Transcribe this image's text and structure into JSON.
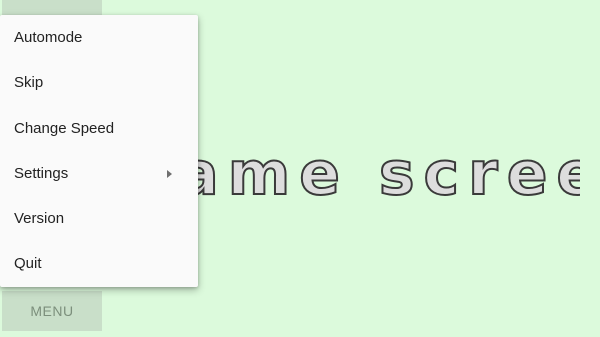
{
  "game": {
    "title_text": "Game screen"
  },
  "menu": {
    "button_label": "MENU",
    "items": [
      {
        "label": "Automode"
      },
      {
        "label": "Skip"
      },
      {
        "label": "Change Speed"
      },
      {
        "label": "Settings",
        "has_submenu": true
      },
      {
        "label": "Version"
      },
      {
        "label": "Quit"
      }
    ]
  },
  "colors": {
    "background": "#dcfadc",
    "button": "#c9dfc9",
    "menu_panel": "#fafafa"
  },
  "icons": {
    "settings_submenu": "caret-right-icon"
  }
}
